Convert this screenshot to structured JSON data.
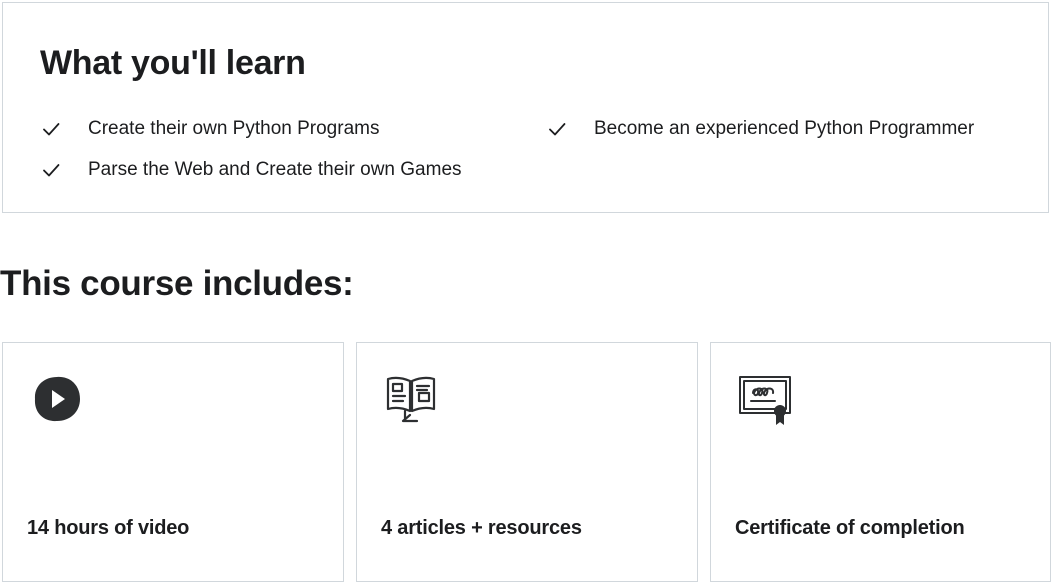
{
  "learn": {
    "title": "What you'll learn",
    "items": [
      {
        "icon": "check-icon",
        "text": "Create their own Python Programs"
      },
      {
        "icon": "check-icon",
        "text": "Become an experienced Python Programmer"
      },
      {
        "icon": "check-icon",
        "text": "Parse the Web and Create their own Games"
      }
    ]
  },
  "includes": {
    "title": "This course includes:",
    "cards": [
      {
        "icon": "play-video-icon",
        "label": "14 hours of video"
      },
      {
        "icon": "open-book-icon",
        "label": "4 articles + resources"
      },
      {
        "icon": "certificate-icon",
        "label": "Certificate of completion"
      }
    ]
  },
  "colors": {
    "text": "#1c1d1f",
    "border": "#d1d7dc",
    "background": "#ffffff"
  }
}
